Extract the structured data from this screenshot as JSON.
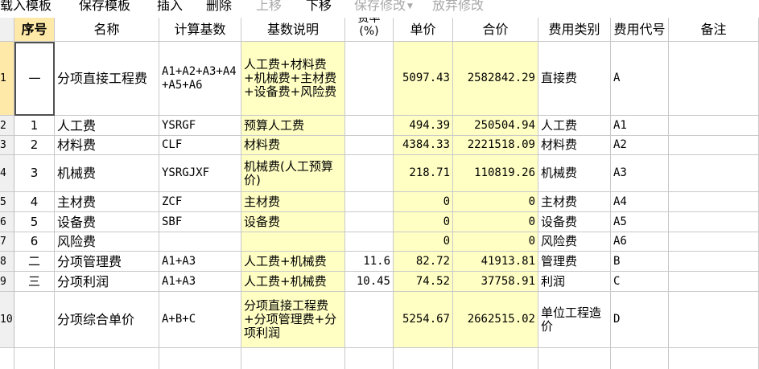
{
  "toolbar": {
    "load_template": "载入模板",
    "save_template": "保存模板",
    "insert": "插入",
    "delete": "删除",
    "move_up": "上移",
    "move_down": "下移",
    "save_changes": "保存修改",
    "discard_changes": "放弃修改"
  },
  "columns": {
    "seq": "序号",
    "name": "名称",
    "base": "计算基数",
    "base_desc": "基数说明",
    "rate_line1": "费率",
    "rate_line2": "(%)",
    "unit_price": "单价",
    "total": "合价",
    "fee_type": "费用类别",
    "fee_code": "费用代号",
    "remark": "备注"
  },
  "rows": [
    {
      "rownum": "1",
      "seq": "一",
      "name": "分项直接工程费",
      "base": "A1+A2+A3+A4+A5+A6",
      "base_desc": "人工费+材料费+机械费+主材费+设备费+风险费",
      "rate": "",
      "unit_price": "5097.43",
      "total": "2582842.29",
      "fee_type": "直接费",
      "fee_code": "A",
      "remark": ""
    },
    {
      "rownum": "2",
      "seq": "1",
      "name": "人工费",
      "base": "YSRGF",
      "base_desc": "预算人工费",
      "rate": "",
      "unit_price": "494.39",
      "total": "250504.94",
      "fee_type": "人工费",
      "fee_code": "A1",
      "remark": ""
    },
    {
      "rownum": "3",
      "seq": "2",
      "name": "材料费",
      "base": "CLF",
      "base_desc": "材料费",
      "rate": "",
      "unit_price": "4384.33",
      "total": "2221518.09",
      "fee_type": "材料费",
      "fee_code": "A2",
      "remark": ""
    },
    {
      "rownum": "4",
      "seq": "3",
      "name": "机械费",
      "base": "YSRGJXF",
      "base_desc": "机械费(人工预算价)",
      "rate": "",
      "unit_price": "218.71",
      "total": "110819.26",
      "fee_type": "机械费",
      "fee_code": "A3",
      "remark": ""
    },
    {
      "rownum": "5",
      "seq": "4",
      "name": "主材费",
      "base": "ZCF",
      "base_desc": "主材费",
      "rate": "",
      "unit_price": "0",
      "total": "0",
      "fee_type": "主材费",
      "fee_code": "A4",
      "remark": ""
    },
    {
      "rownum": "6",
      "seq": "5",
      "name": "设备费",
      "base": "SBF",
      "base_desc": "设备费",
      "rate": "",
      "unit_price": "0",
      "total": "0",
      "fee_type": "设备费",
      "fee_code": "A5",
      "remark": ""
    },
    {
      "rownum": "7",
      "seq": "6",
      "name": "风险费",
      "base": "",
      "base_desc": "",
      "rate": "",
      "unit_price": "0",
      "total": "0",
      "fee_type": "风险费",
      "fee_code": "A6",
      "remark": ""
    },
    {
      "rownum": "8",
      "seq": "二",
      "name": "分项管理费",
      "base": "A1+A3",
      "base_desc": "人工费+机械费",
      "rate": "11.6",
      "unit_price": "82.72",
      "total": "41913.81",
      "fee_type": "管理费",
      "fee_code": "B",
      "remark": ""
    },
    {
      "rownum": "9",
      "seq": "三",
      "name": "分项利润",
      "base": "A1+A3",
      "base_desc": "人工费+机械费",
      "rate": "10.45",
      "unit_price": "74.52",
      "total": "37758.91",
      "fee_type": "利润",
      "fee_code": "C",
      "remark": ""
    },
    {
      "rownum": "10",
      "seq": "",
      "name": "分项综合单价",
      "base": "A+B+C",
      "base_desc": "分项直接工程费+分项管理费+分项利润",
      "rate": "",
      "unit_price": "5254.67",
      "total": "2662515.02",
      "fee_type": "单位工程造价",
      "fee_code": "D",
      "remark": ""
    }
  ]
}
